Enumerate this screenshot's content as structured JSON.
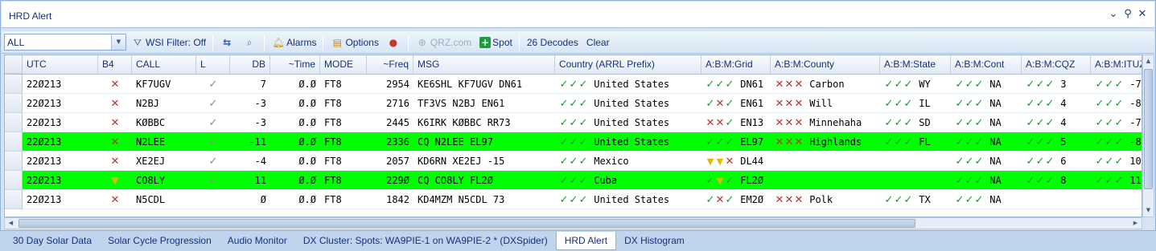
{
  "window": {
    "title": "HRD Alert"
  },
  "toolbar": {
    "filter_value": "ALL",
    "wsi_label": "WSI Filter: Off",
    "alarms_label": "Alarms",
    "options_label": "Options",
    "qrz_label": "QRZ.com",
    "spot_label": "Spot",
    "decodes_label": "26 Decodes",
    "clear_label": "Clear"
  },
  "columns": [
    "UTC",
    "B4",
    "CALL",
    "L",
    "DB",
    "~Time",
    "MODE",
    "~Freq",
    "MSG",
    "Country (ARRL Prefix)",
    "A:B:M:Grid",
    "A:B:M:County",
    "A:B:M:State",
    "A:B:M:Cont",
    "A:B:M:CQZ",
    "A:B:M:ITUZ"
  ],
  "rows": [
    {
      "highlight": false,
      "utc": "22Ø213",
      "b4": "x",
      "call": "KF7UGV",
      "l": "check",
      "db": "7",
      "time": "Ø.Ø",
      "mode": "FT8",
      "freq": "2954",
      "msg": "KE6SHL KF7UGV DN61",
      "country_marks": [
        "k",
        "k",
        "k"
      ],
      "country": "United States",
      "grid_marks": [
        "k",
        "k",
        "k"
      ],
      "grid": "DN61",
      "county_marks": [
        "x",
        "x",
        "x"
      ],
      "county": "Carbon",
      "state_marks": [
        "k",
        "k",
        "k"
      ],
      "state": "WY",
      "cont_marks": [
        "k",
        "k",
        "k"
      ],
      "cont": "NA",
      "cqz_marks": [
        "k",
        "k",
        "k"
      ],
      "cqz": "3",
      "ituz_marks": [
        "k",
        "k",
        "k"
      ],
      "ituz": "-7"
    },
    {
      "highlight": false,
      "utc": "22Ø213",
      "b4": "x",
      "call": "N2BJ",
      "l": "check",
      "db": "-3",
      "time": "Ø.Ø",
      "mode": "FT8",
      "freq": "2716",
      "msg": "TF3VS N2BJ EN61",
      "country_marks": [
        "k",
        "k",
        "k"
      ],
      "country": "United States",
      "grid_marks": [
        "k",
        "x",
        "k"
      ],
      "grid": "EN61",
      "county_marks": [
        "x",
        "x",
        "x"
      ],
      "county": "Will",
      "state_marks": [
        "k",
        "k",
        "k"
      ],
      "state": "IL",
      "cont_marks": [
        "k",
        "k",
        "k"
      ],
      "cont": "NA",
      "cqz_marks": [
        "k",
        "k",
        "k"
      ],
      "cqz": "4",
      "ituz_marks": [
        "k",
        "k",
        "k"
      ],
      "ituz": "-8"
    },
    {
      "highlight": false,
      "utc": "22Ø213",
      "b4": "x",
      "call": "KØBBC",
      "l": "check",
      "db": "-3",
      "time": "Ø.Ø",
      "mode": "FT8",
      "freq": "2445",
      "msg": "K6IRK KØBBC RR73",
      "country_marks": [
        "k",
        "k",
        "k"
      ],
      "country": "United States",
      "grid_marks": [
        "x",
        "x",
        "k"
      ],
      "grid": "EN13",
      "county_marks": [
        "x",
        "x",
        "x"
      ],
      "county": "Minnehaha",
      "state_marks": [
        "k",
        "k",
        "k"
      ],
      "state": "SD",
      "cont_marks": [
        "k",
        "k",
        "k"
      ],
      "cont": "NA",
      "cqz_marks": [
        "k",
        "k",
        "k"
      ],
      "cqz": "4",
      "ituz_marks": [
        "k",
        "k",
        "k"
      ],
      "ituz": "-7"
    },
    {
      "highlight": true,
      "utc": "22Ø213",
      "b4": "x",
      "call": "N2LEE",
      "l": "check",
      "db": "-11",
      "time": "Ø.Ø",
      "mode": "FT8",
      "freq": "2336",
      "msg": "CQ N2LEE EL97",
      "country_marks": [
        "k",
        "k",
        "k"
      ],
      "country": "United States",
      "grid_marks": [
        "k",
        "k",
        "k"
      ],
      "grid": "EL97",
      "county_marks": [
        "x",
        "x",
        "x"
      ],
      "county": "Highlands",
      "state_marks": [
        "k",
        "k",
        "k"
      ],
      "state": "FL",
      "cont_marks": [
        "k",
        "k",
        "k"
      ],
      "cont": "NA",
      "cqz_marks": [
        "k",
        "k",
        "k"
      ],
      "cqz": "5",
      "ituz_marks": [
        "k",
        "k",
        "k"
      ],
      "ituz": "-8"
    },
    {
      "highlight": false,
      "utc": "22Ø213",
      "b4": "x",
      "call": "XE2EJ",
      "l": "check",
      "db": "-4",
      "time": "Ø.Ø",
      "mode": "FT8",
      "freq": "2057",
      "msg": "KD6RN XE2EJ -15",
      "country_marks": [
        "k",
        "k",
        "k"
      ],
      "country": "Mexico",
      "grid_marks": [
        "t",
        "t",
        "x"
      ],
      "grid": "DL44",
      "county_marks": [],
      "county": "",
      "state_marks": [],
      "state": "",
      "cont_marks": [
        "k",
        "k",
        "k"
      ],
      "cont": "NA",
      "cqz_marks": [
        "k",
        "k",
        "k"
      ],
      "cqz": "6",
      "ituz_marks": [
        "k",
        "k",
        "k"
      ],
      "ituz": "10"
    },
    {
      "highlight": true,
      "utc": "22Ø213",
      "b4": "tri",
      "call": "CO8LY",
      "l": "check",
      "db": "11",
      "time": "Ø.Ø",
      "mode": "FT8",
      "freq": "229Ø",
      "msg": "CQ CO8LY FL2Ø",
      "country_marks": [
        "k",
        "k",
        "k"
      ],
      "country": "Cuba",
      "grid_marks": [
        "k",
        "t",
        "k"
      ],
      "grid": "FL2Ø",
      "county_marks": [],
      "county": "",
      "state_marks": [],
      "state": "",
      "cont_marks": [
        "k",
        "k",
        "k"
      ],
      "cont": "NA",
      "cqz_marks": [
        "k",
        "k",
        "k"
      ],
      "cqz": "8",
      "ituz_marks": [
        "k",
        "k",
        "k"
      ],
      "ituz": "11"
    },
    {
      "highlight": false,
      "utc": "22Ø213",
      "b4": "x",
      "call": "N5CDL",
      "l": "",
      "db": "Ø",
      "time": "Ø.Ø",
      "mode": "FT8",
      "freq": "1842",
      "msg": "KD4MZM N5CDL 73",
      "country_marks": [
        "k",
        "k",
        "k"
      ],
      "country": "United States",
      "grid_marks": [
        "k",
        "x",
        "k"
      ],
      "grid": "EM2Ø",
      "county_marks": [
        "x",
        "x",
        "x"
      ],
      "county": "Polk",
      "state_marks": [
        "k",
        "k",
        "k"
      ],
      "state": "TX",
      "cont_marks": [
        "k",
        "k",
        "k"
      ],
      "cont": "NA",
      "cqz_marks": [],
      "cqz": "",
      "ituz_marks": [],
      "ituz": ""
    }
  ],
  "tabs": [
    "30 Day Solar Data",
    "Solar Cycle Progression",
    "Audio Monitor",
    "DX Cluster: Spots: WA9PIE-1 on WA9PIE-2 * (DXSpider)",
    "HRD Alert",
    "DX Histogram"
  ],
  "active_tab": "HRD Alert",
  "colors": {
    "highlight": "#00ff00",
    "check": "#1a9a2e",
    "cross": "#c0302a",
    "warn": "#e5b800"
  }
}
